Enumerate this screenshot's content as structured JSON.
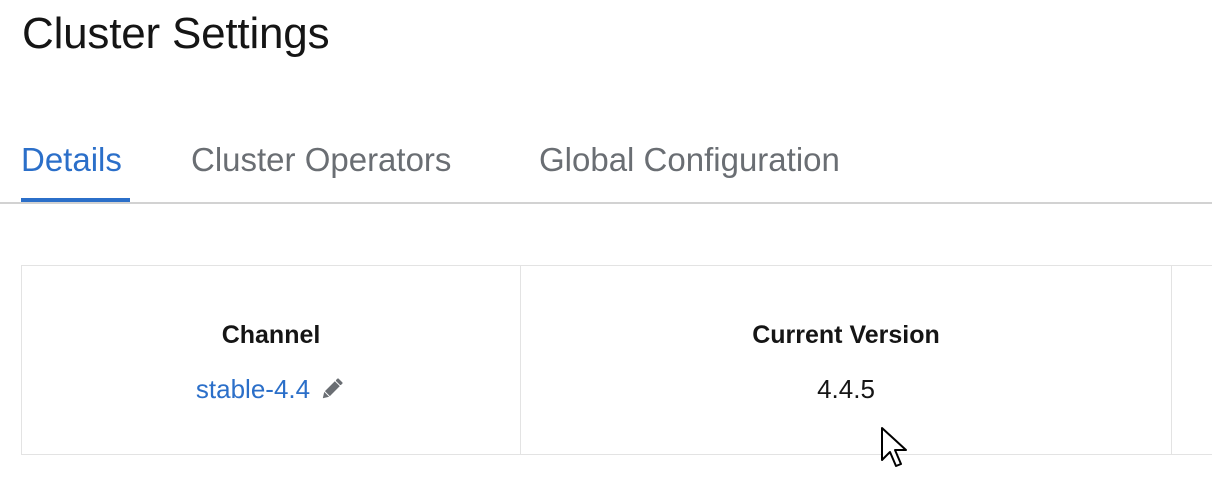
{
  "page": {
    "title": "Cluster Settings"
  },
  "tabs": [
    {
      "label": "Details",
      "active": true
    },
    {
      "label": "Cluster Operators",
      "active": false
    },
    {
      "label": "Global Configuration",
      "active": false
    }
  ],
  "details": {
    "channel": {
      "label": "Channel",
      "value": "stable-4.4",
      "edit_icon": "pencil-icon"
    },
    "current_version": {
      "label": "Current Version",
      "value": "4.4.5"
    }
  },
  "colors": {
    "accent": "#2b6fc9",
    "text": "#151515",
    "muted": "#6a6e73",
    "border": "#e3e3e3"
  }
}
